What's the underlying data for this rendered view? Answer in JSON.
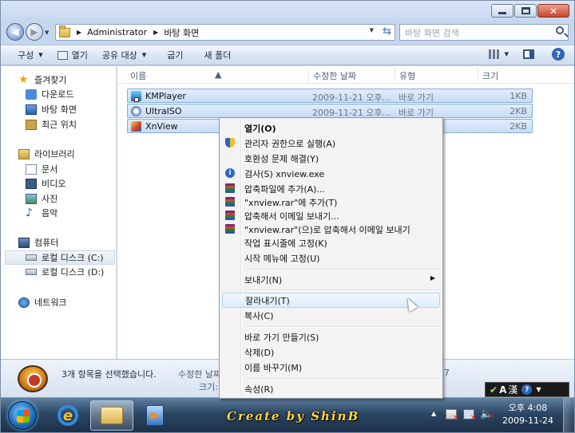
{
  "address": {
    "crumbs": [
      "Administrator",
      "바탕 화면"
    ],
    "search_placeholder": "바탕 화면 검색"
  },
  "toolbar": {
    "organize": "구성",
    "open": "열기",
    "share": "공유 대상",
    "burn": "굽기",
    "new_folder": "새 폴더"
  },
  "sidebar": {
    "favorites": "즐겨찾기",
    "downloads": "다운로드",
    "desktop": "바탕 화면",
    "recent": "최근 위치",
    "libraries": "라이브러리",
    "documents": "문서",
    "videos": "비디오",
    "pictures": "사진",
    "music": "음악",
    "computer": "컴퓨터",
    "drive_c": "로컬 디스크 (C:)",
    "drive_d": "로컬 디스크 (D:)",
    "network": "네트워크"
  },
  "columns": {
    "name": "이름",
    "date": "수정한 날짜",
    "type": "유형",
    "size": "크기"
  },
  "files": [
    {
      "name": "KMPlayer",
      "date": "2009-11-21 오후...",
      "type": "바로 가기",
      "size": "1KB"
    },
    {
      "name": "UltraISO",
      "date": "2009-11-21 오후...",
      "type": "바로 가기",
      "size": "2KB"
    },
    {
      "name": "XnView",
      "date": "",
      "type": "",
      "size": "2KB"
    }
  ],
  "details": {
    "selected": "3개 항목을 선택했습니다.",
    "modified_label": "수정한 날짜:",
    "size_label": "크기:",
    "suffix": "7"
  },
  "context_menu": {
    "open": "열기(O)",
    "run_as_admin": "관리자 권한으로 실행(A)",
    "troubleshoot": "호환성 문제 해결(Y)",
    "scan": "검사(S) xnview.exe",
    "add_archive": "압축파일에 추가(A)...",
    "add_rar": "\"xnview.rar\"에 추가(T)",
    "compress_email": "압축해서 이메일 보내기...",
    "compress_rar_email": "\"xnview.rar\"(으)로 압축해서 이메일 보내기",
    "pin_taskbar": "작업 표시줄에 고정(K)",
    "pin_start": "시작 메뉴에 고정(U)",
    "send_to": "보내기(N)",
    "cut": "잘라내기(T)",
    "copy": "복사(C)",
    "create_shortcut": "바로 가기 만들기(S)",
    "delete": "삭제(D)",
    "rename": "이름 바꾸기(M)",
    "properties": "속성(R)"
  },
  "langbar": {
    "mode": "A",
    "hanja": "漢",
    "help": "?"
  },
  "taskbar": {
    "brand": "Create by ShinB",
    "time": "오후 4:08",
    "date": "2009-11-24"
  },
  "icons": {
    "back": "back-arrow-icon",
    "forward": "forward-arrow-icon",
    "refresh": "refresh-icon",
    "search": "search-icon",
    "help": "help-icon"
  },
  "colors": {
    "selection": "#c8dcf5",
    "menu_hover": "#dcedfc",
    "taskbar": "#2b4663"
  }
}
